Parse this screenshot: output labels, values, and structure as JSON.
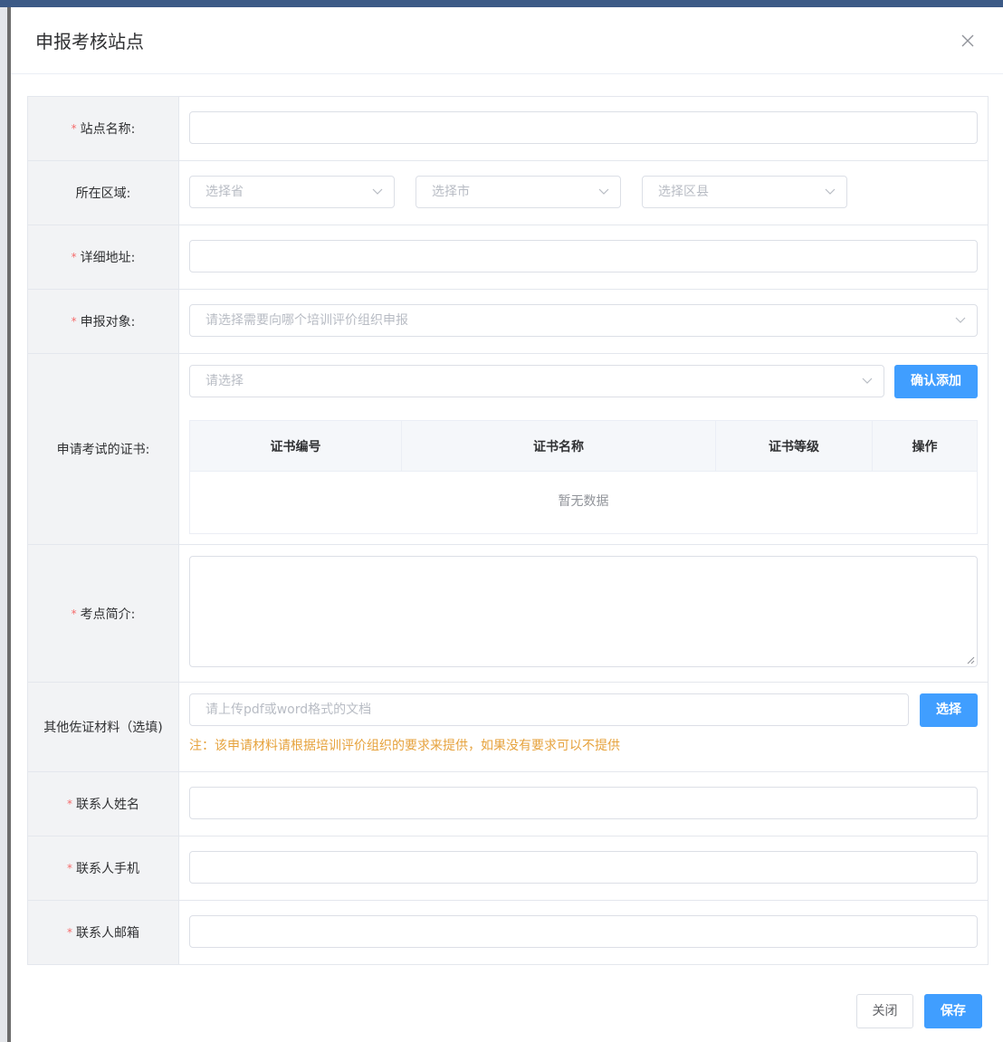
{
  "dialog": {
    "title": "申报考核站点",
    "close_icon": "close-icon"
  },
  "form": {
    "site_name": {
      "label": "站点名称:",
      "required": true,
      "value": ""
    },
    "region": {
      "label": "所在区域:",
      "province_placeholder": "选择省",
      "city_placeholder": "选择市",
      "district_placeholder": "选择区县"
    },
    "address": {
      "label": "详细地址:",
      "required": true,
      "value": ""
    },
    "target": {
      "label": "申报对象:",
      "required": true,
      "placeholder": "请选择需要向哪个培训评价组织申报"
    },
    "certificates": {
      "label": "申请考试的证书:",
      "select_placeholder": "请选择",
      "add_button": "确认添加",
      "columns": [
        "证书编号",
        "证书名称",
        "证书等级",
        "操作"
      ],
      "empty_text": "暂无数据"
    },
    "intro": {
      "label": "考点简介:",
      "required": true,
      "value": ""
    },
    "materials": {
      "label": "其他佐证材料（选填)",
      "placeholder": "请上传pdf或word格式的文档",
      "choose_button": "选择",
      "note": "注：该申请材料请根据培训评价组织的要求来提供，如果没有要求可以不提供"
    },
    "contact_name": {
      "label": "联系人姓名",
      "required": true,
      "value": ""
    },
    "contact_phone": {
      "label": "联系人手机",
      "required": true,
      "value": ""
    },
    "contact_email": {
      "label": "联系人邮箱",
      "required": true,
      "value": ""
    },
    "required_mark": "*"
  },
  "footer": {
    "close_label": "关闭",
    "save_label": "保存"
  },
  "colors": {
    "primary": "#409eff",
    "required": "#f56c6c",
    "warning": "#e6a23c",
    "label_bg": "#f2f3f5"
  }
}
